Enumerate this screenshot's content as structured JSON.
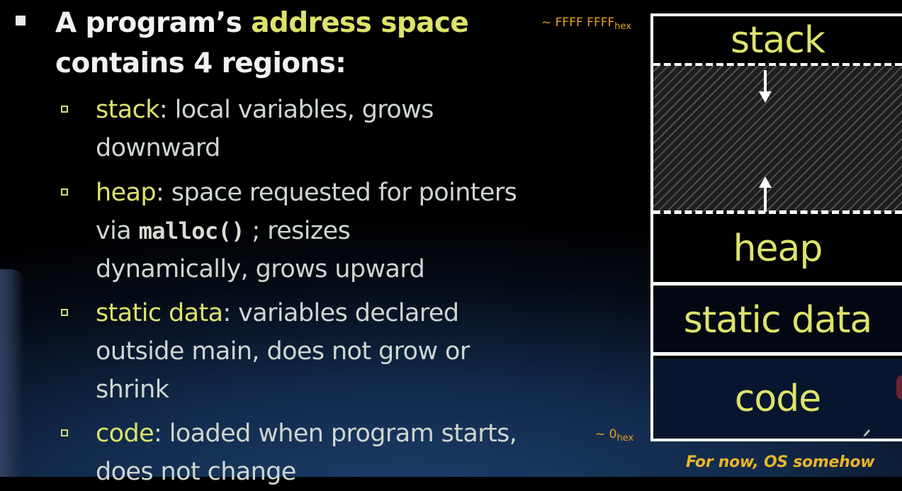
{
  "headline": {
    "line1_prefix": "A program’s ",
    "line1_highlight": "address space",
    "line2": "contains 4 regions:"
  },
  "bullets": [
    {
      "term": "stack",
      "line1_rest": ": local variables, grows",
      "line2": "downward"
    },
    {
      "term": "heap",
      "line1_rest": ": space requested for pointers",
      "line2_prefix": "via ",
      "line2_code": "malloc()",
      "line2_suffix": " ; resizes",
      "line3": "dynamically, grows upward"
    },
    {
      "term": "static data",
      "line1_rest": ": variables declared",
      "line2": "outside main, does not grow or",
      "line3": "shrink"
    },
    {
      "term": "code",
      "line1_rest": ": loaded when program starts,",
      "line2": "does not change"
    }
  ],
  "addresses": {
    "top_value": "~ FFFF FFFF",
    "top_subscript": "hex",
    "bottom_value": "~ 0",
    "bottom_subscript": "hex"
  },
  "diagram": {
    "regions": [
      "stack",
      "heap",
      "static data",
      "code"
    ]
  },
  "caption": "For now, OS somehow",
  "colors": {
    "highlight": "#dde36a",
    "body_text": "#cfd6d0",
    "address_label": "#e8a11a",
    "caption": "#e8b52a",
    "diagram_border": "#ffffff"
  }
}
